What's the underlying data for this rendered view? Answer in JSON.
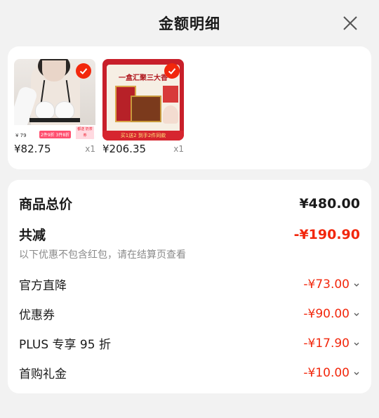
{
  "header": {
    "title": "金额明细"
  },
  "products": [
    {
      "price": "¥82.75",
      "qty": "x1",
      "image_text": {
        "left_tag": "¥ 79",
        "mid_tag": "2件9折 3件8折",
        "right_tag": "都送 奶茶券"
      }
    },
    {
      "price": "¥206.35",
      "qty": "x1",
      "image_text": {
        "banner": "一盒汇聚三大香",
        "footer": "买1送2 到手2件同款"
      }
    }
  ],
  "summary": {
    "total_label": "商品总价",
    "total_value": "¥480.00",
    "reduce_label": "共减",
    "reduce_value": "-¥190.90",
    "note": "以下优惠不包含红包，请在结算页查看"
  },
  "discounts": [
    {
      "label": "官方直降",
      "value": "-¥73.00"
    },
    {
      "label": "优惠券",
      "value": "-¥90.00"
    },
    {
      "label": "PLUS 专享 95 折",
      "value": "-¥17.90"
    },
    {
      "label": "首购礼金",
      "value": "-¥10.00"
    }
  ],
  "colors": {
    "accent": "#f2270c",
    "background": "#f2f2f2",
    "card": "#ffffff"
  },
  "icons": {
    "close": "close-icon",
    "check": "check-icon",
    "chevron": "chevron-down-icon"
  }
}
